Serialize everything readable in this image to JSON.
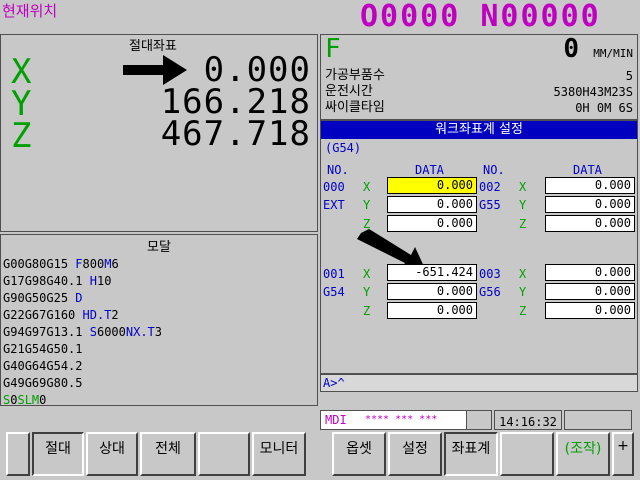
{
  "header": {
    "title": "현재위치",
    "program_number": "O0000 N00000"
  },
  "position": {
    "title": "절대좌표",
    "axes": [
      {
        "name": "X",
        "value": "0.000"
      },
      {
        "name": "Y",
        "value": "166.218"
      },
      {
        "name": "Z",
        "value": "467.718"
      }
    ]
  },
  "feed": {
    "label": "F",
    "value": "0",
    "unit": "MM/MIN",
    "parts_label": "가공부품수",
    "parts_value": "5",
    "runtime_label": "운전시간",
    "runtime_value": "5380H43M23S",
    "cycle_label": "싸이클타임",
    "cycle_value": "0H 0M 6S"
  },
  "work_offset": {
    "title": "워크좌표계 설정",
    "current": "(G54)",
    "headers": {
      "no": "NO.",
      "data": "DATA"
    },
    "groups": [
      {
        "left": {
          "no": "000",
          "code": "EXT",
          "rows": [
            {
              "axis": "X",
              "value": "0.000"
            },
            {
              "axis": "Y",
              "value": "0.000"
            },
            {
              "axis": "Z",
              "value": "0.000"
            }
          ]
        },
        "right": {
          "no": "002",
          "code": "G55",
          "rows": [
            {
              "axis": "X",
              "value": "0.000"
            },
            {
              "axis": "Y",
              "value": "0.000"
            },
            {
              "axis": "Z",
              "value": "0.000"
            }
          ]
        }
      },
      {
        "left": {
          "no": "001",
          "code": "G54",
          "rows": [
            {
              "axis": "X",
              "value": "-651.424"
            },
            {
              "axis": "Y",
              "value": "0.000"
            },
            {
              "axis": "Z",
              "value": "0.000"
            }
          ]
        },
        "right": {
          "no": "003",
          "code": "G56",
          "rows": [
            {
              "axis": "X",
              "value": "0.000"
            },
            {
              "axis": "Y",
              "value": "0.000"
            },
            {
              "axis": "Z",
              "value": "0.000"
            }
          ]
        }
      }
    ]
  },
  "modal": {
    "title": "모달",
    "rows": [
      [
        "G00",
        "G80",
        "G15"
      ],
      [
        "G17",
        "G98",
        "G40.1"
      ],
      [
        "G90",
        "G50",
        "G25"
      ],
      [
        "G22",
        "G67",
        "G160"
      ],
      [
        "G94",
        "G97",
        "G13.1"
      ],
      [
        "G21",
        "G54",
        "G50.1"
      ],
      [
        "G40",
        "G64",
        "G54.2"
      ],
      [
        "G49",
        "G69",
        "G80.5"
      ]
    ],
    "f_label": "F",
    "f_value": "800",
    "m_label": "M",
    "m_value": "6",
    "h_label": "H",
    "h_value": "10",
    "d_label": "D",
    "hdt_label": "HD.T",
    "hdt_value": "2",
    "s_label": "S",
    "s_value": "6000",
    "nxt_label": "NX.T",
    "nxt_value": "3",
    "s2_label": "S",
    "s2_value": "0",
    "slm_label": "SLM",
    "slm_value": "0"
  },
  "input": {
    "prompt": "A>^"
  },
  "status": {
    "mode": "MDI",
    "state": "**** *** ***",
    "time": "14:16:32"
  },
  "softkeys": [
    "절대",
    "상대",
    "전체",
    "",
    "모니터",
    "옵셋",
    "설정",
    "좌표계",
    "",
    "(조작)",
    "+"
  ]
}
